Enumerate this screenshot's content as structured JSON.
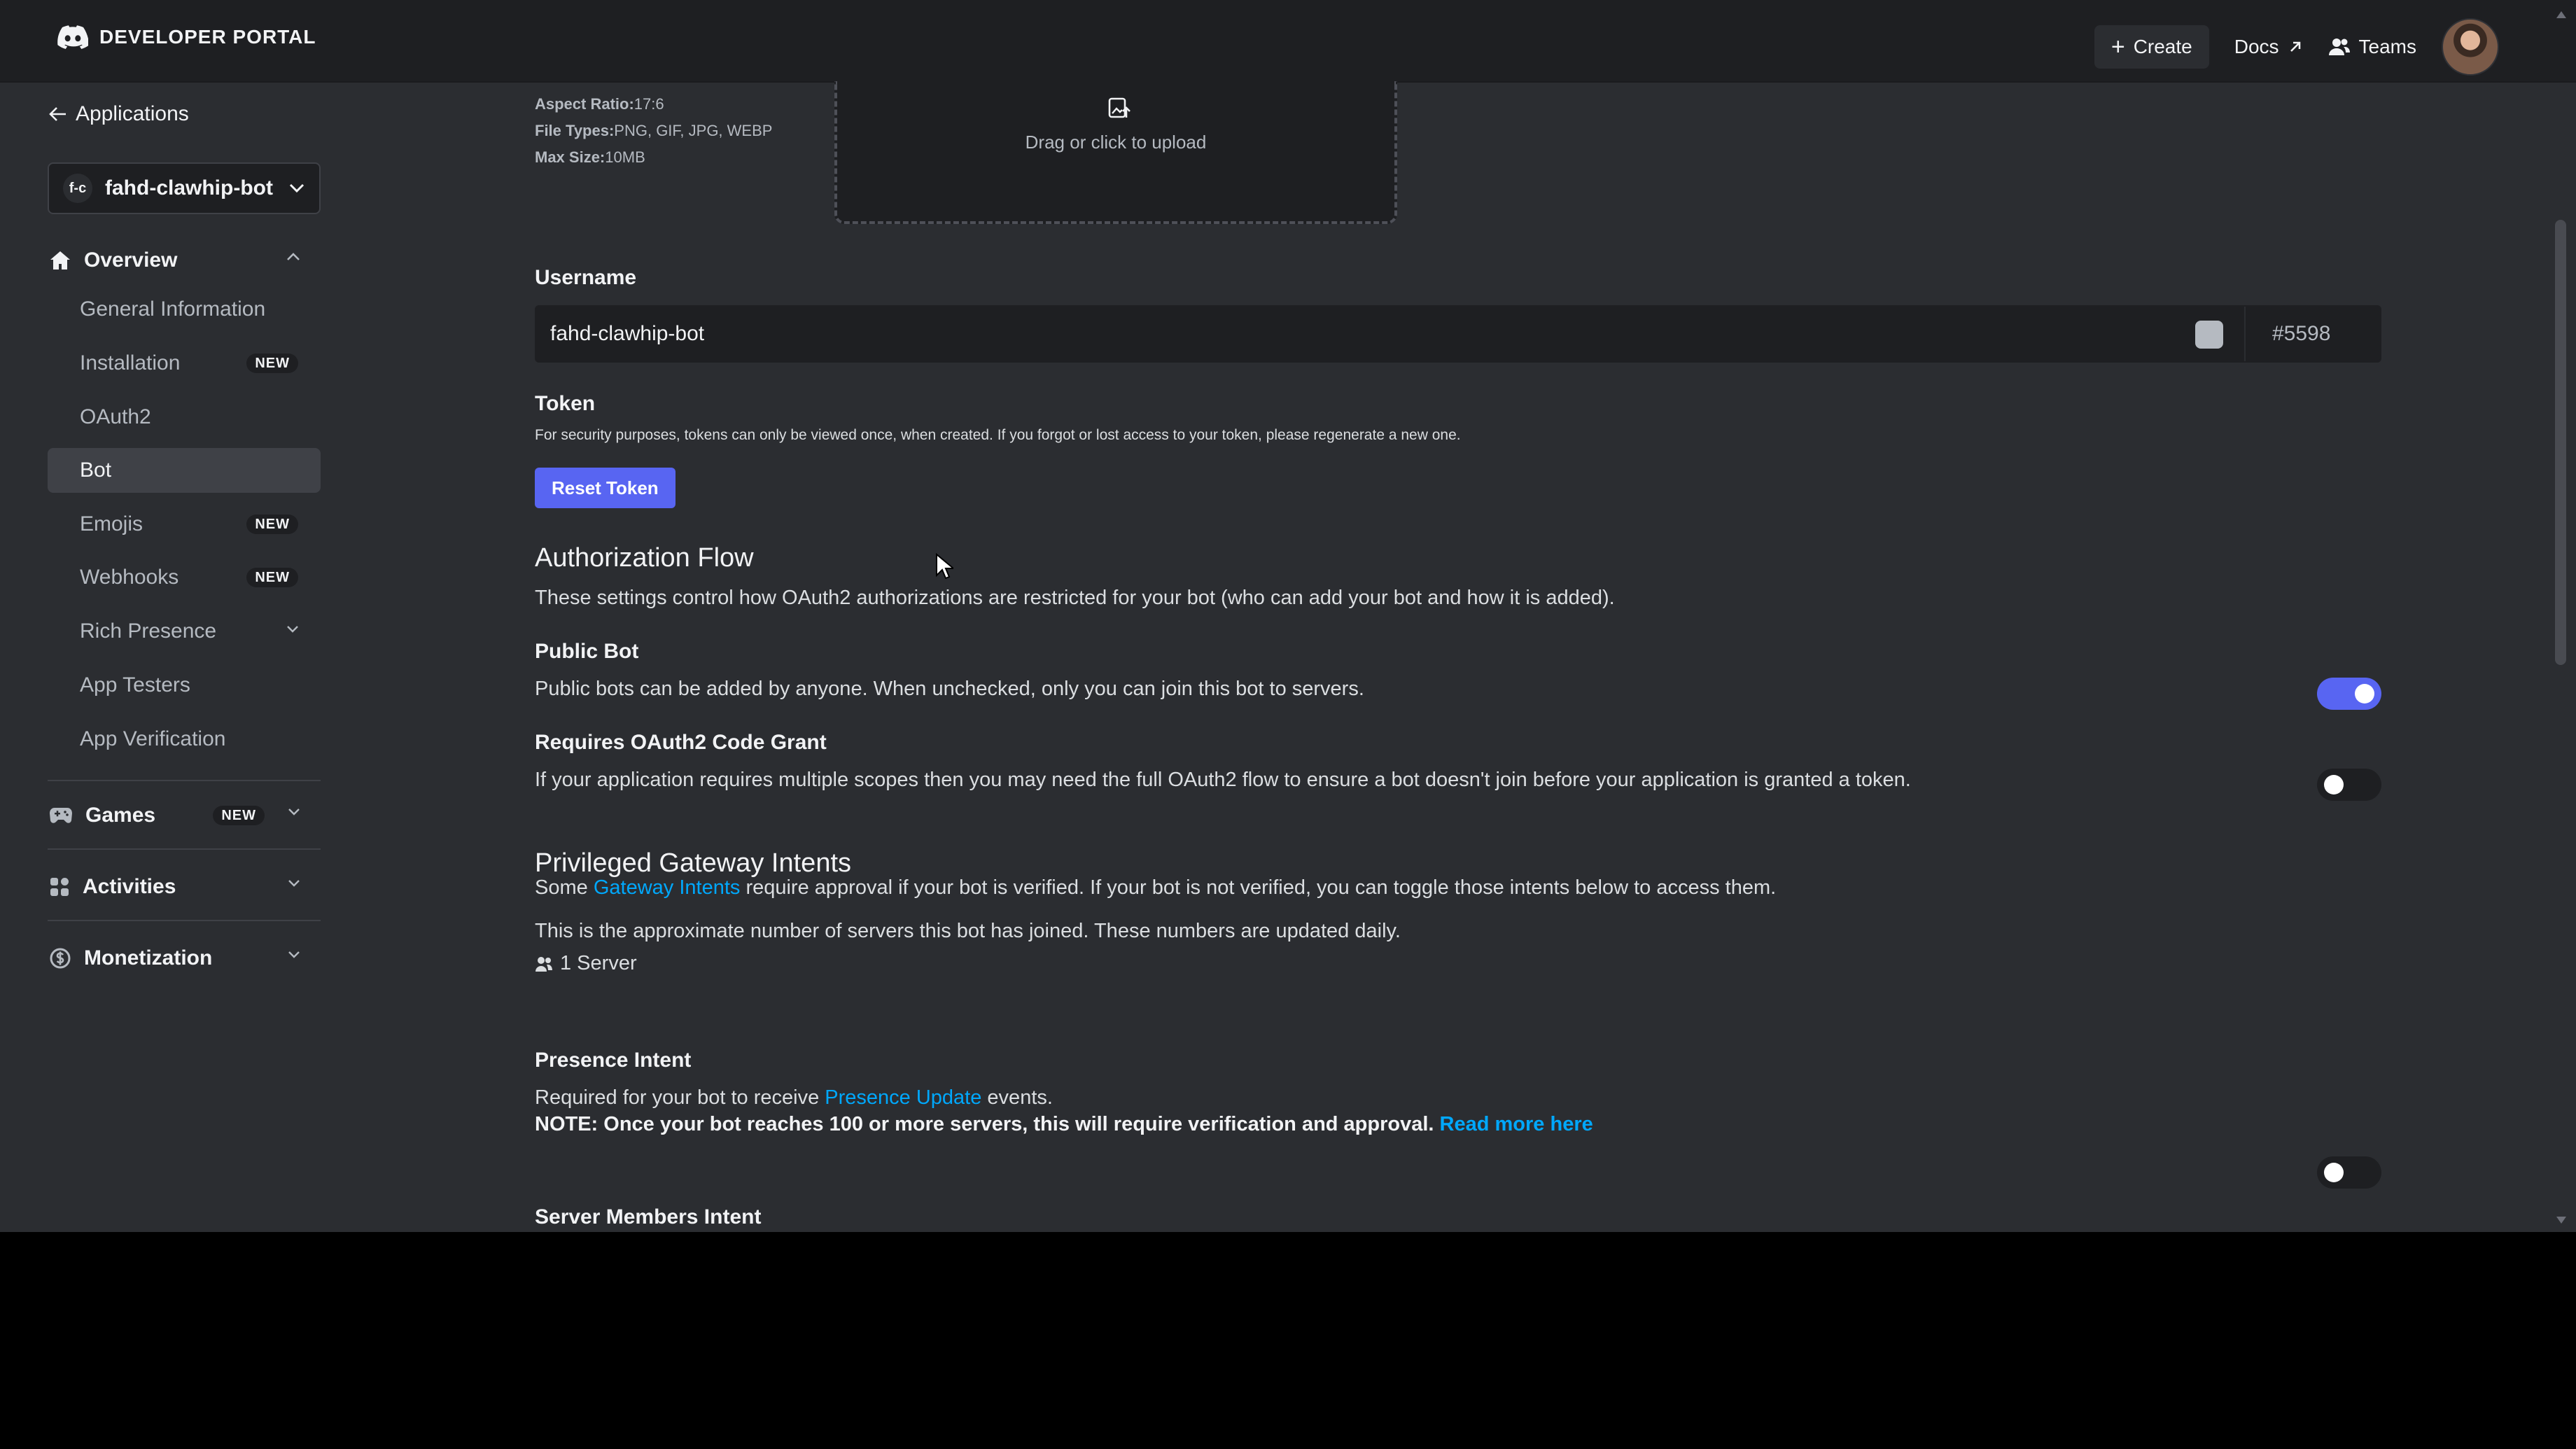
{
  "header": {
    "brand": "DEVELOPER PORTAL",
    "create_label": "Create",
    "docs_label": "Docs",
    "teams_label": "Teams"
  },
  "sidebar": {
    "back_label": "Applications",
    "app_badge": "f-c",
    "app_name": "fahd-clawhip-bot",
    "overview_label": "Overview",
    "items": [
      {
        "label": "General Information"
      },
      {
        "label": "Installation",
        "badge": "NEW"
      },
      {
        "label": "OAuth2"
      },
      {
        "label": "Bot"
      },
      {
        "label": "Emojis",
        "badge": "NEW"
      },
      {
        "label": "Webhooks",
        "badge": "NEW"
      },
      {
        "label": "Rich Presence"
      },
      {
        "label": "App Testers"
      },
      {
        "label": "App Verification"
      }
    ],
    "sections": [
      {
        "label": "Games",
        "badge": "NEW"
      },
      {
        "label": "Activities"
      },
      {
        "label": "Monetization"
      }
    ]
  },
  "banner": {
    "aspect_key": "Aspect Ratio:",
    "aspect_val": "17:6",
    "types_key": "File Types:",
    "types_val": "PNG, GIF, JPG, WEBP",
    "size_key": "Max Size:",
    "size_val": "10MB",
    "upload_text": "Drag or click to upload"
  },
  "username": {
    "label": "Username",
    "value": "fahd-clawhip-bot",
    "discriminator": "#5598"
  },
  "token": {
    "label": "Token",
    "description": "For security purposes, tokens can only be viewed once, when created. If you forgot or lost access to your token, please regenerate a new one.",
    "button": "Reset Token"
  },
  "auth_flow": {
    "heading": "Authorization Flow",
    "description": "These settings control how OAuth2 authorizations are restricted for your bot (who can add your bot and how it is added).",
    "public_bot": {
      "label": "Public Bot",
      "description": "Public bots can be added by anyone. When unchecked, only you can join this bot to servers.",
      "enabled": true
    },
    "code_grant": {
      "label": "Requires OAuth2 Code Grant",
      "description": "If your application requires multiple scopes then you may need the full OAuth2 flow to ensure a bot doesn't join before your application is granted a token.",
      "enabled": false
    }
  },
  "intents": {
    "heading": "Privileged Gateway Intents",
    "desc_prefix": "Some ",
    "desc_link": "Gateway Intents",
    "desc_suffix": " require approval if your bot is verified. If your bot is not verified, you can toggle those intents below to access them.",
    "approx_text": "This is the approximate number of servers this bot has joined. These numbers are updated daily.",
    "server_count": "1 Server",
    "presence": {
      "label": "Presence Intent",
      "desc_prefix": "Required for your bot to receive ",
      "desc_link": "Presence Update",
      "desc_suffix": " events.",
      "note": "NOTE: Once your bot reaches 100 or more servers, this will require verification and approval.",
      "note_link": "Read more here",
      "enabled": false
    },
    "server_members_label": "Server Members Intent"
  },
  "colors": {
    "accent": "#5865f2",
    "link": "#00a8fc",
    "background": "#2b2d31",
    "topbar": "#1e1f22"
  }
}
